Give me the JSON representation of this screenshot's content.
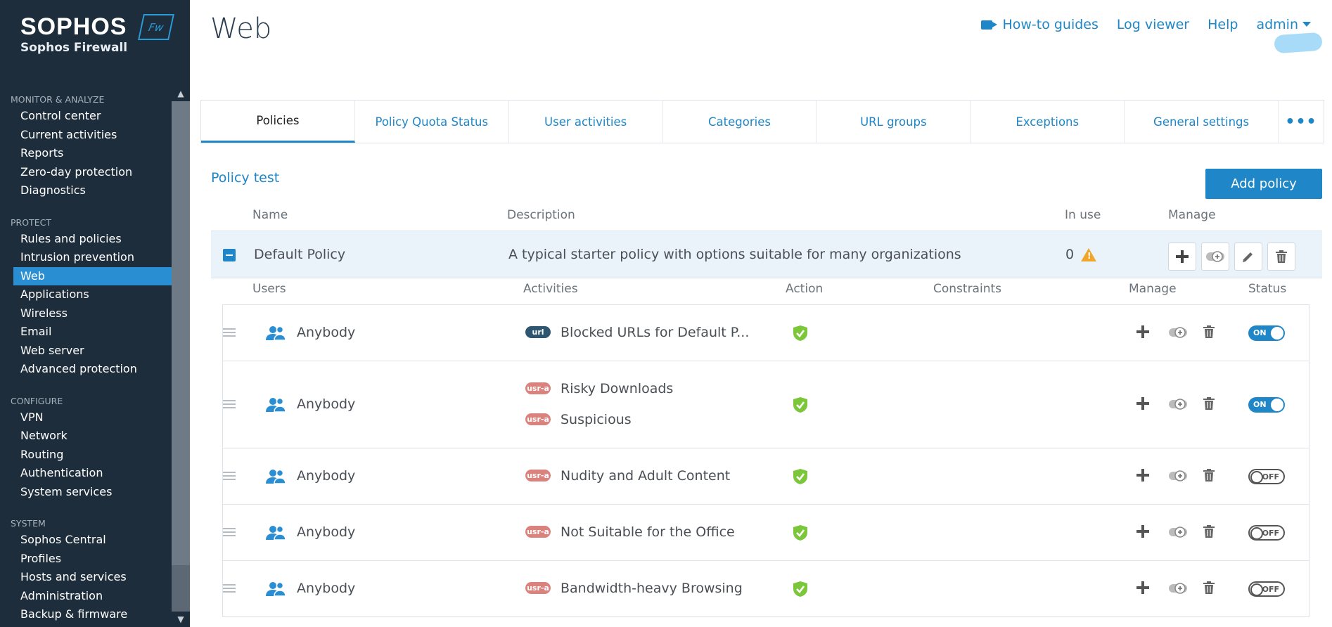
{
  "brand": {
    "logo": "SOPHOS",
    "product": "Sophos Firewall",
    "badge": "Fw"
  },
  "sidebar": {
    "sections": [
      {
        "title": "MONITOR & ANALYZE",
        "items": [
          "Control center",
          "Current activities",
          "Reports",
          "Zero-day protection",
          "Diagnostics"
        ]
      },
      {
        "title": "PROTECT",
        "items": [
          "Rules and policies",
          "Intrusion prevention",
          "Web",
          "Applications",
          "Wireless",
          "Email",
          "Web server",
          "Advanced protection"
        ]
      },
      {
        "title": "CONFIGURE",
        "items": [
          "VPN",
          "Network",
          "Routing",
          "Authentication",
          "System services"
        ]
      },
      {
        "title": "SYSTEM",
        "items": [
          "Sophos Central",
          "Profiles",
          "Hosts and services",
          "Administration",
          "Backup & firmware"
        ]
      }
    ],
    "active": "Web"
  },
  "header": {
    "title": "Web",
    "links": {
      "guides": "How-to guides",
      "log": "Log viewer",
      "help": "Help",
      "user": "admin"
    }
  },
  "tabs": [
    "Policies",
    "Policy Quota Status",
    "User activities",
    "Categories",
    "URL groups",
    "Exceptions",
    "General settings"
  ],
  "tab_more": "•••",
  "policy_test": "Policy test",
  "add_policy": "Add policy",
  "columns": {
    "name": "Name",
    "description": "Description",
    "in_use": "In use",
    "manage": "Manage"
  },
  "policy": {
    "name": "Default Policy",
    "description": "A typical starter policy with options suitable for many organizations",
    "in_use": "0"
  },
  "rule_columns": {
    "users": "Users",
    "activities": "Activities",
    "action": "Action",
    "constraints": "Constraints",
    "manage": "Manage",
    "status": "Status"
  },
  "rules": [
    {
      "user": "Anybody",
      "activities": [
        {
          "tag": "url",
          "label": "Blocked URLs for Default P..."
        }
      ],
      "status": "ON"
    },
    {
      "user": "Anybody",
      "activities": [
        {
          "tag": "usr-a",
          "label": "Risky Downloads"
        },
        {
          "tag": "usr-a",
          "label": "Suspicious"
        }
      ],
      "status": "ON"
    },
    {
      "user": "Anybody",
      "activities": [
        {
          "tag": "usr-a",
          "label": "Nudity and Adult Content"
        }
      ],
      "status": "OFF"
    },
    {
      "user": "Anybody",
      "activities": [
        {
          "tag": "usr-a",
          "label": "Not Suitable for the Office"
        }
      ],
      "status": "OFF"
    },
    {
      "user": "Anybody",
      "activities": [
        {
          "tag": "usr-a",
          "label": "Bandwidth-heavy Browsing"
        }
      ],
      "status": "OFF"
    }
  ],
  "colors": {
    "sidebar_bg": "#1e2d3b",
    "accent": "#1f86c7",
    "active_nav": "#2a8fd2",
    "warning": "#f0a52c",
    "allow_green": "#7cc63a",
    "pill_url": "#2f5670",
    "pill_user": "#d9827e"
  }
}
